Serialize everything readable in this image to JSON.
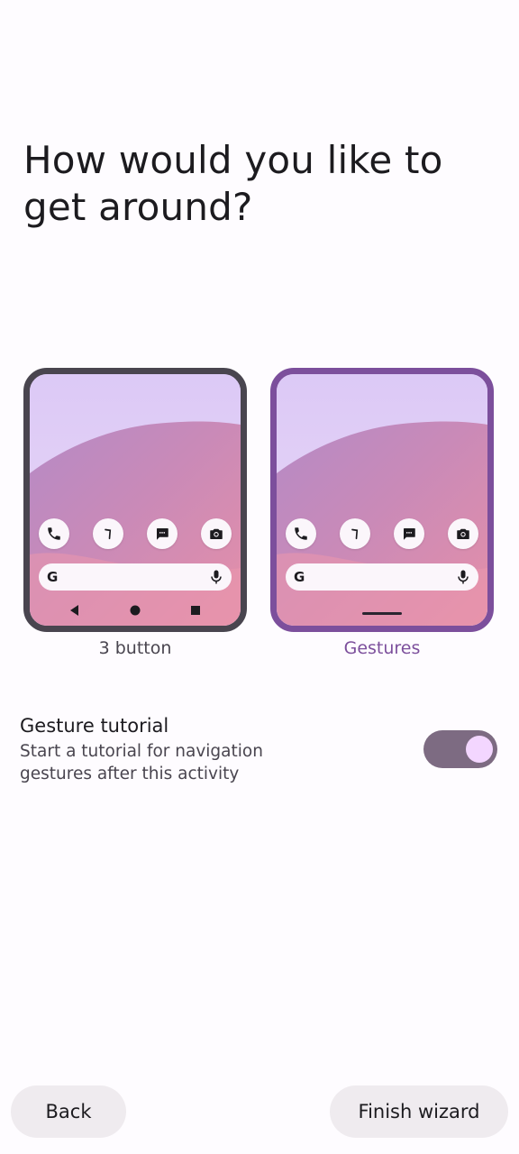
{
  "page": {
    "title": "How would you like to get around?"
  },
  "nav_options": [
    {
      "label": "3 button",
      "selected": false,
      "border_color": "#49454f"
    },
    {
      "label": "Gestures",
      "selected": true,
      "border_color": "#7c4f9c"
    }
  ],
  "preview": {
    "search_logo": "G",
    "dock_icons": [
      "phone-icon",
      "clock-icon",
      "messages-icon",
      "camera-icon"
    ],
    "nav_buttons": [
      "back-triangle-icon",
      "home-circle-icon",
      "recents-square-icon"
    ]
  },
  "gesture_tutorial": {
    "title": "Gesture tutorial",
    "description": "Start a tutorial for navigation gestures after this activity",
    "enabled": true,
    "track_color": "#7d6b82",
    "knob_color": "#f3d6ff"
  },
  "footer": {
    "back_label": "Back",
    "finish_label": "Finish wizard"
  },
  "colors": {
    "accent": "#7c4f9c",
    "background": "#fefcff",
    "button_bg": "#efebef"
  }
}
